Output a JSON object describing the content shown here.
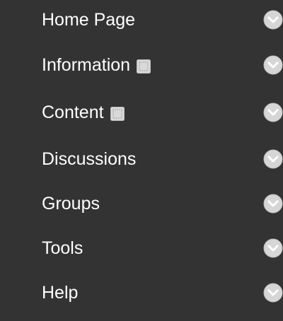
{
  "menu": {
    "items": [
      {
        "label": "Home Page",
        "hidden_icon": false,
        "icon": "chevron-down-icon"
      },
      {
        "label": "Information",
        "hidden_icon": true,
        "icon": "chevron-down-icon"
      },
      {
        "label": "Content",
        "hidden_icon": true,
        "icon": "chevron-down-icon"
      },
      {
        "label": "Discussions",
        "hidden_icon": false,
        "icon": "chevron-down-icon"
      },
      {
        "label": "Groups",
        "hidden_icon": false,
        "icon": "chevron-down-icon"
      },
      {
        "label": "Tools",
        "hidden_icon": false,
        "icon": "chevron-down-icon"
      },
      {
        "label": "Help",
        "hidden_icon": false,
        "icon": "chevron-down-icon"
      }
    ]
  },
  "colors": {
    "background": "#333333",
    "text": "#ffffff",
    "icon_fill": "#d6d6d6",
    "icon_stroke": "#bdbdbd",
    "chevron": "#ffffff"
  }
}
